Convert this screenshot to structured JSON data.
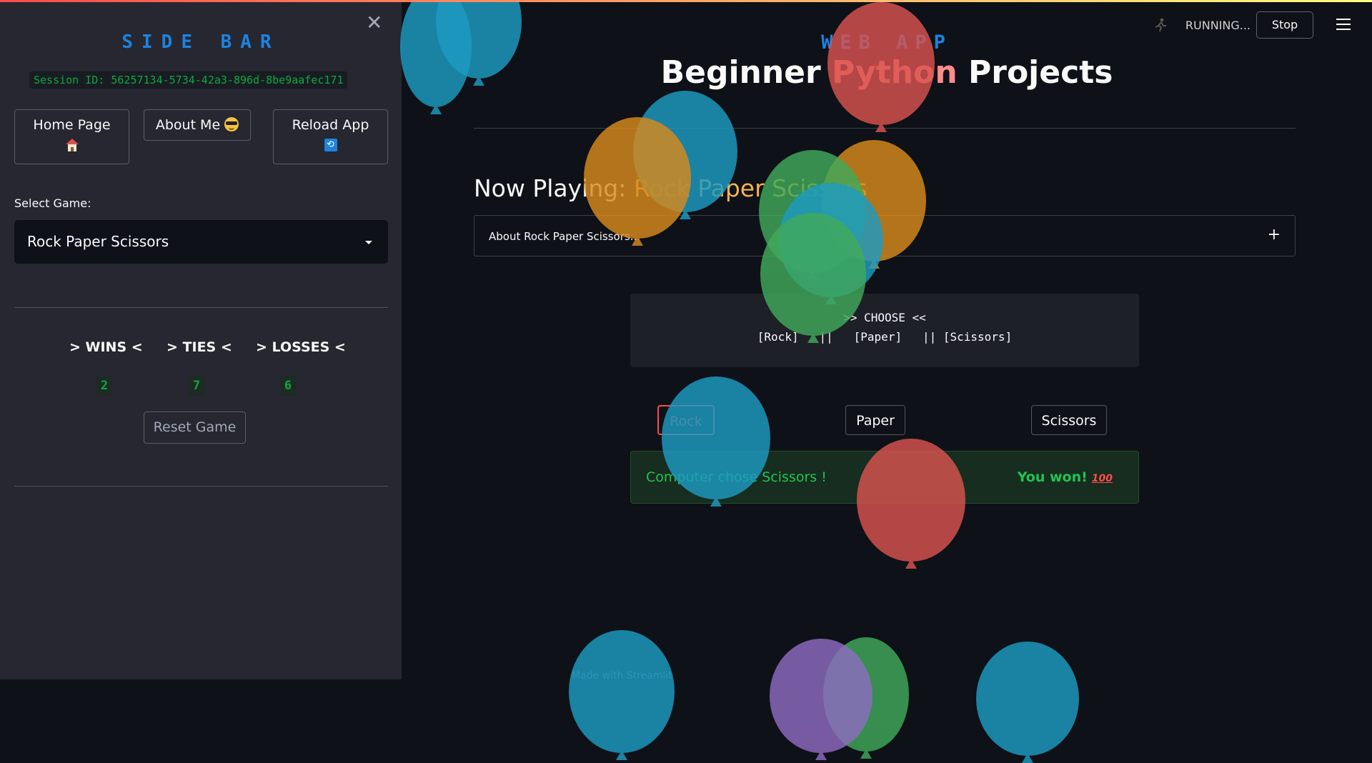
{
  "sidebar": {
    "title": "SIDE BAR",
    "close_icon": "close-icon",
    "session": "Session ID: 56257134-5734-42a3-896d-8be9aafec171",
    "buttons": {
      "home": "Home Page",
      "home_icon": "house-icon",
      "about": "About Me",
      "about_icon": "smiley-sunglasses-icon",
      "reload": "Reload App",
      "reload_icon": "refresh-icon"
    },
    "select_label": "Select Game:",
    "selected_game": "Rock Paper Scissors",
    "score": {
      "wins_label": "> WINS <",
      "ties_label": "> TIES <",
      "losses_label": "> LOSSES <",
      "wins": "2",
      "ties": "7",
      "losses": "6"
    },
    "reset_label": "Reset Game"
  },
  "header": {
    "status": "RUNNING...",
    "stop_label": "Stop",
    "menu_icon": "hamburger-menu-icon"
  },
  "main": {
    "app_small": "WEB APP",
    "title_part1": "Beginner ",
    "title_highlight": "Python",
    "title_part2": " Projects",
    "now_playing_prefix": "Now Playing: ",
    "now_playing_game": "Rock Paper Scissors",
    "expander_label": "About Rock Paper Scissors...",
    "choose_line1": ">> CHOOSE <<",
    "choose_line2": "[Rock]   ||   [Paper]   || [Scissors]",
    "buttons": [
      "Rock",
      "Paper",
      "Scissors"
    ],
    "result_message": "Computer chose Scissors !",
    "result_outcome": "You won!",
    "result_emoji": "100",
    "footer": "Made with Streamlit"
  },
  "colors": {
    "accent_blue": "#1c83e1",
    "success_green": "#21c354",
    "danger_red": "#ff4b4b",
    "sidebar_bg": "#262730",
    "main_bg": "#0e1117"
  }
}
